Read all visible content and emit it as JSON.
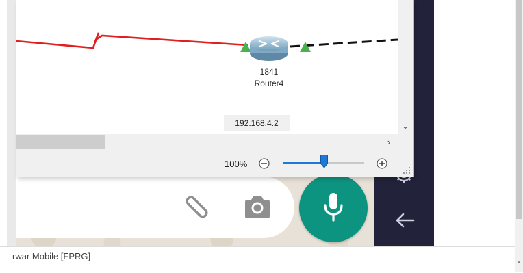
{
  "packet_tracer": {
    "router": {
      "model": "1841",
      "name": "Router4",
      "ip": "192.168.4.2"
    },
    "zoom": {
      "label": "100%",
      "level_fraction": 0.5
    },
    "link_colors": {
      "serial": "#e02020",
      "ethernet": "#111111",
      "link_up": "#4caf50"
    }
  },
  "chat": {
    "attach_icon": "paperclip-icon",
    "camera_icon": "camera-icon",
    "mic_icon": "microphone-icon",
    "accent_color": "#0d9480"
  },
  "sidebar": {
    "icons": [
      "gear-icon",
      "back-arrow-icon"
    ]
  },
  "footer": {
    "text": "rwar Mobile [FPRG]"
  }
}
